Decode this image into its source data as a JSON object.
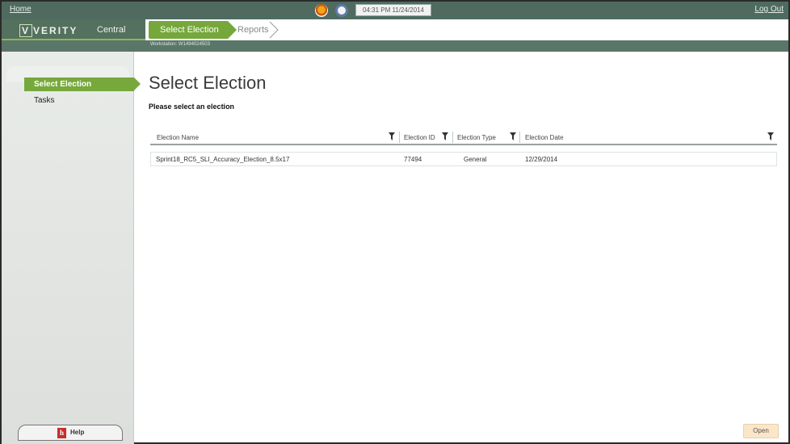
{
  "topbar": {
    "home_label": "Home",
    "logout_label": "Log Out",
    "datetime": "04:31 PM 11/24/2014",
    "status_icons": [
      "printer-status-icon",
      "connection-status-icon"
    ]
  },
  "brand": {
    "product": "VERITY",
    "module": "Central"
  },
  "breadcrumbs": [
    {
      "label": "Select Election",
      "active": true
    },
    {
      "label": "Reports",
      "active": false
    }
  ],
  "workstation": "Workstation: W1494024503",
  "sidebar": {
    "items": [
      {
        "label": "Select Election",
        "active": true
      },
      {
        "label": "Tasks",
        "active": false
      }
    ],
    "help_label": "Help"
  },
  "main": {
    "title": "Select Election",
    "subtitle": "Please select an election",
    "columns": [
      "Election Name",
      "Election ID",
      "Election Type",
      "Election Date"
    ],
    "rows": [
      {
        "name": "Sprint18_RC5_SLI_Accuracy_Election_8.5x17",
        "id": "77494",
        "type": "General",
        "date": "12/29/2014"
      }
    ],
    "open_label": "Open"
  },
  "colors": {
    "accent_green": "#76a73b",
    "header_green": "#54705f",
    "open_button": "#fbe6c9"
  }
}
